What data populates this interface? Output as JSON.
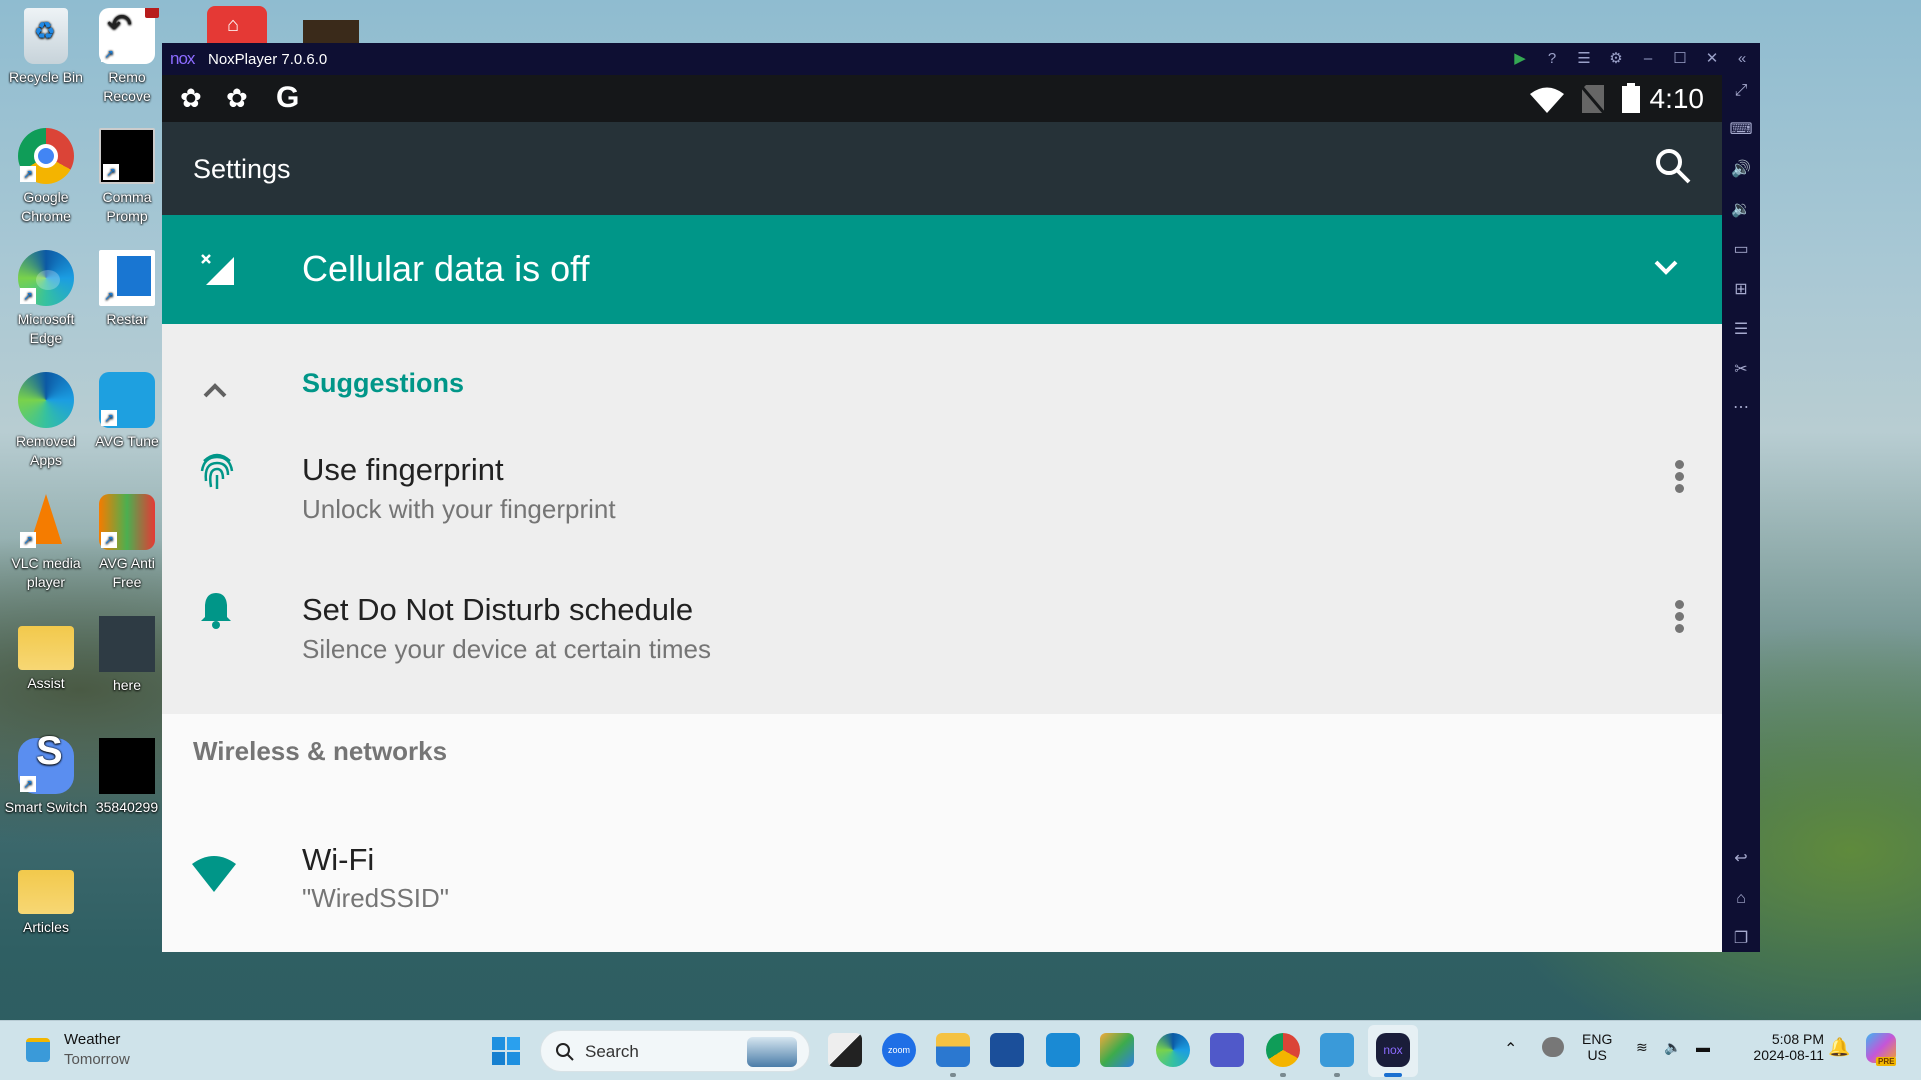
{
  "desktop": {
    "icons": [
      {
        "label": "Recycle Bin",
        "icon": "recycle-bin-icon"
      },
      {
        "label": "Remo Recove",
        "icon": "remo-recover-icon"
      },
      {
        "label": "Google Chrome",
        "icon": "chrome-icon"
      },
      {
        "label": "Comma Promp",
        "icon": "command-prompt-icon"
      },
      {
        "label": "Microsoft Edge",
        "icon": "edge-icon"
      },
      {
        "label": "Restar",
        "icon": "restart-icon"
      },
      {
        "label": "Removed Apps",
        "icon": "edge-icon"
      },
      {
        "label": "AVG Tune",
        "icon": "avg-tuneup-icon"
      },
      {
        "label": "VLC media player",
        "icon": "vlc-icon"
      },
      {
        "label": "AVG Anti Free",
        "icon": "avg-antivirus-icon"
      },
      {
        "label": "Assist",
        "icon": "folder-icon"
      },
      {
        "label": "here",
        "icon": "image-thumbnail-icon"
      },
      {
        "label": "Smart Switch",
        "icon": "smart-switch-icon"
      },
      {
        "label": "35840299",
        "icon": "image-thumbnail-icon"
      },
      {
        "label": "Articles",
        "icon": "folder-icon"
      }
    ]
  },
  "nox": {
    "logo": "nox",
    "title": "NoxPlayer 7.0.6.0",
    "title_buttons": [
      "play-store",
      "help",
      "menu",
      "settings",
      "minimize",
      "maximize",
      "close",
      "collapse-sidebar"
    ],
    "sidebar_top": [
      "fullscreen",
      "keyboard",
      "volume-up",
      "volume-down",
      "screen",
      "apk-install",
      "multi-instance",
      "screenshot",
      "more"
    ],
    "sidebar_bottom": [
      "back",
      "home",
      "recents"
    ]
  },
  "android": {
    "status_bar": {
      "time": "4:10",
      "notif_icons": [
        "app-notification",
        "app-notification",
        "google"
      ]
    },
    "app_bar": {
      "title": "Settings"
    },
    "banner": {
      "text": "Cellular data is off",
      "accent": "#009688"
    },
    "suggestions": {
      "header": "Suggestions",
      "items": [
        {
          "title": "Use fingerprint",
          "subtitle": "Unlock with your fingerprint",
          "icon": "fingerprint"
        },
        {
          "title": "Set Do Not Disturb schedule",
          "subtitle": "Silence your device at certain times",
          "icon": "bell"
        }
      ]
    },
    "wireless": {
      "header": "Wireless & networks",
      "items": [
        {
          "title": "Wi-Fi",
          "subtitle": "\"WiredSSID\"",
          "icon": "wifi"
        }
      ]
    }
  },
  "taskbar": {
    "weather": {
      "title": "Weather",
      "subtitle": "Tomorrow"
    },
    "search_label": "Search",
    "apps": [
      "start",
      "task-view",
      "zoom",
      "file-explorer",
      "microsoft-store",
      "phone-link",
      "photos",
      "edge",
      "teams",
      "chrome",
      "notepad",
      "noxplayer"
    ],
    "tray": {
      "lang_top": "ENG",
      "lang_bottom": "US",
      "time": "5:08 PM",
      "date": "2024-08-11",
      "copilot_badge": "PRE"
    }
  }
}
